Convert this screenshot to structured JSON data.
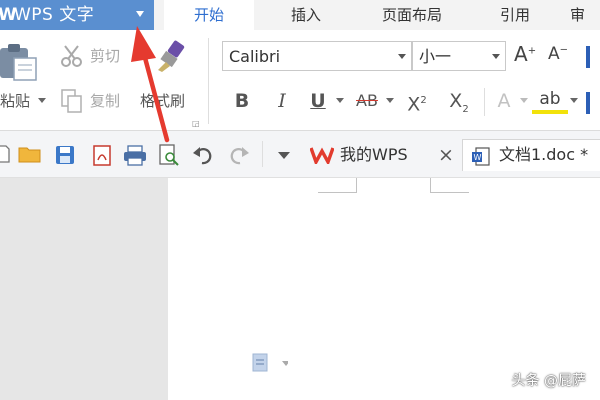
{
  "app": {
    "name": "WPS 文字",
    "logo_letter": "W"
  },
  "menu": {
    "tabs": [
      {
        "label": "开始",
        "active": true
      },
      {
        "label": "插入",
        "active": false
      },
      {
        "label": "页面布局",
        "active": false
      },
      {
        "label": "引用",
        "active": false
      },
      {
        "label": "审",
        "active": false
      }
    ]
  },
  "ribbon": {
    "clipboard": {
      "paste_label": "粘贴",
      "cut_label": "剪切",
      "copy_label": "复制",
      "format_painter_label": "格式刷"
    },
    "font": {
      "family": "Calibri",
      "size": "小一",
      "grow": "A",
      "shrink": "A",
      "bold": "B",
      "italic": "I",
      "underline": "U",
      "strikethrough": "AB",
      "superscript": "X",
      "subscript": "X",
      "clear": "A",
      "highlight": "ab"
    }
  },
  "doc_tabs": [
    {
      "label": "我的WPS",
      "close": "×"
    },
    {
      "label": "文档1.doc *"
    }
  ],
  "watermark": "头条 @屁萨",
  "colors": {
    "app_button": "#5a8fd0",
    "active_tab_text": "#2f6fd0",
    "arrow": "#e53a2f",
    "wps_logo": "#e23b2e"
  }
}
